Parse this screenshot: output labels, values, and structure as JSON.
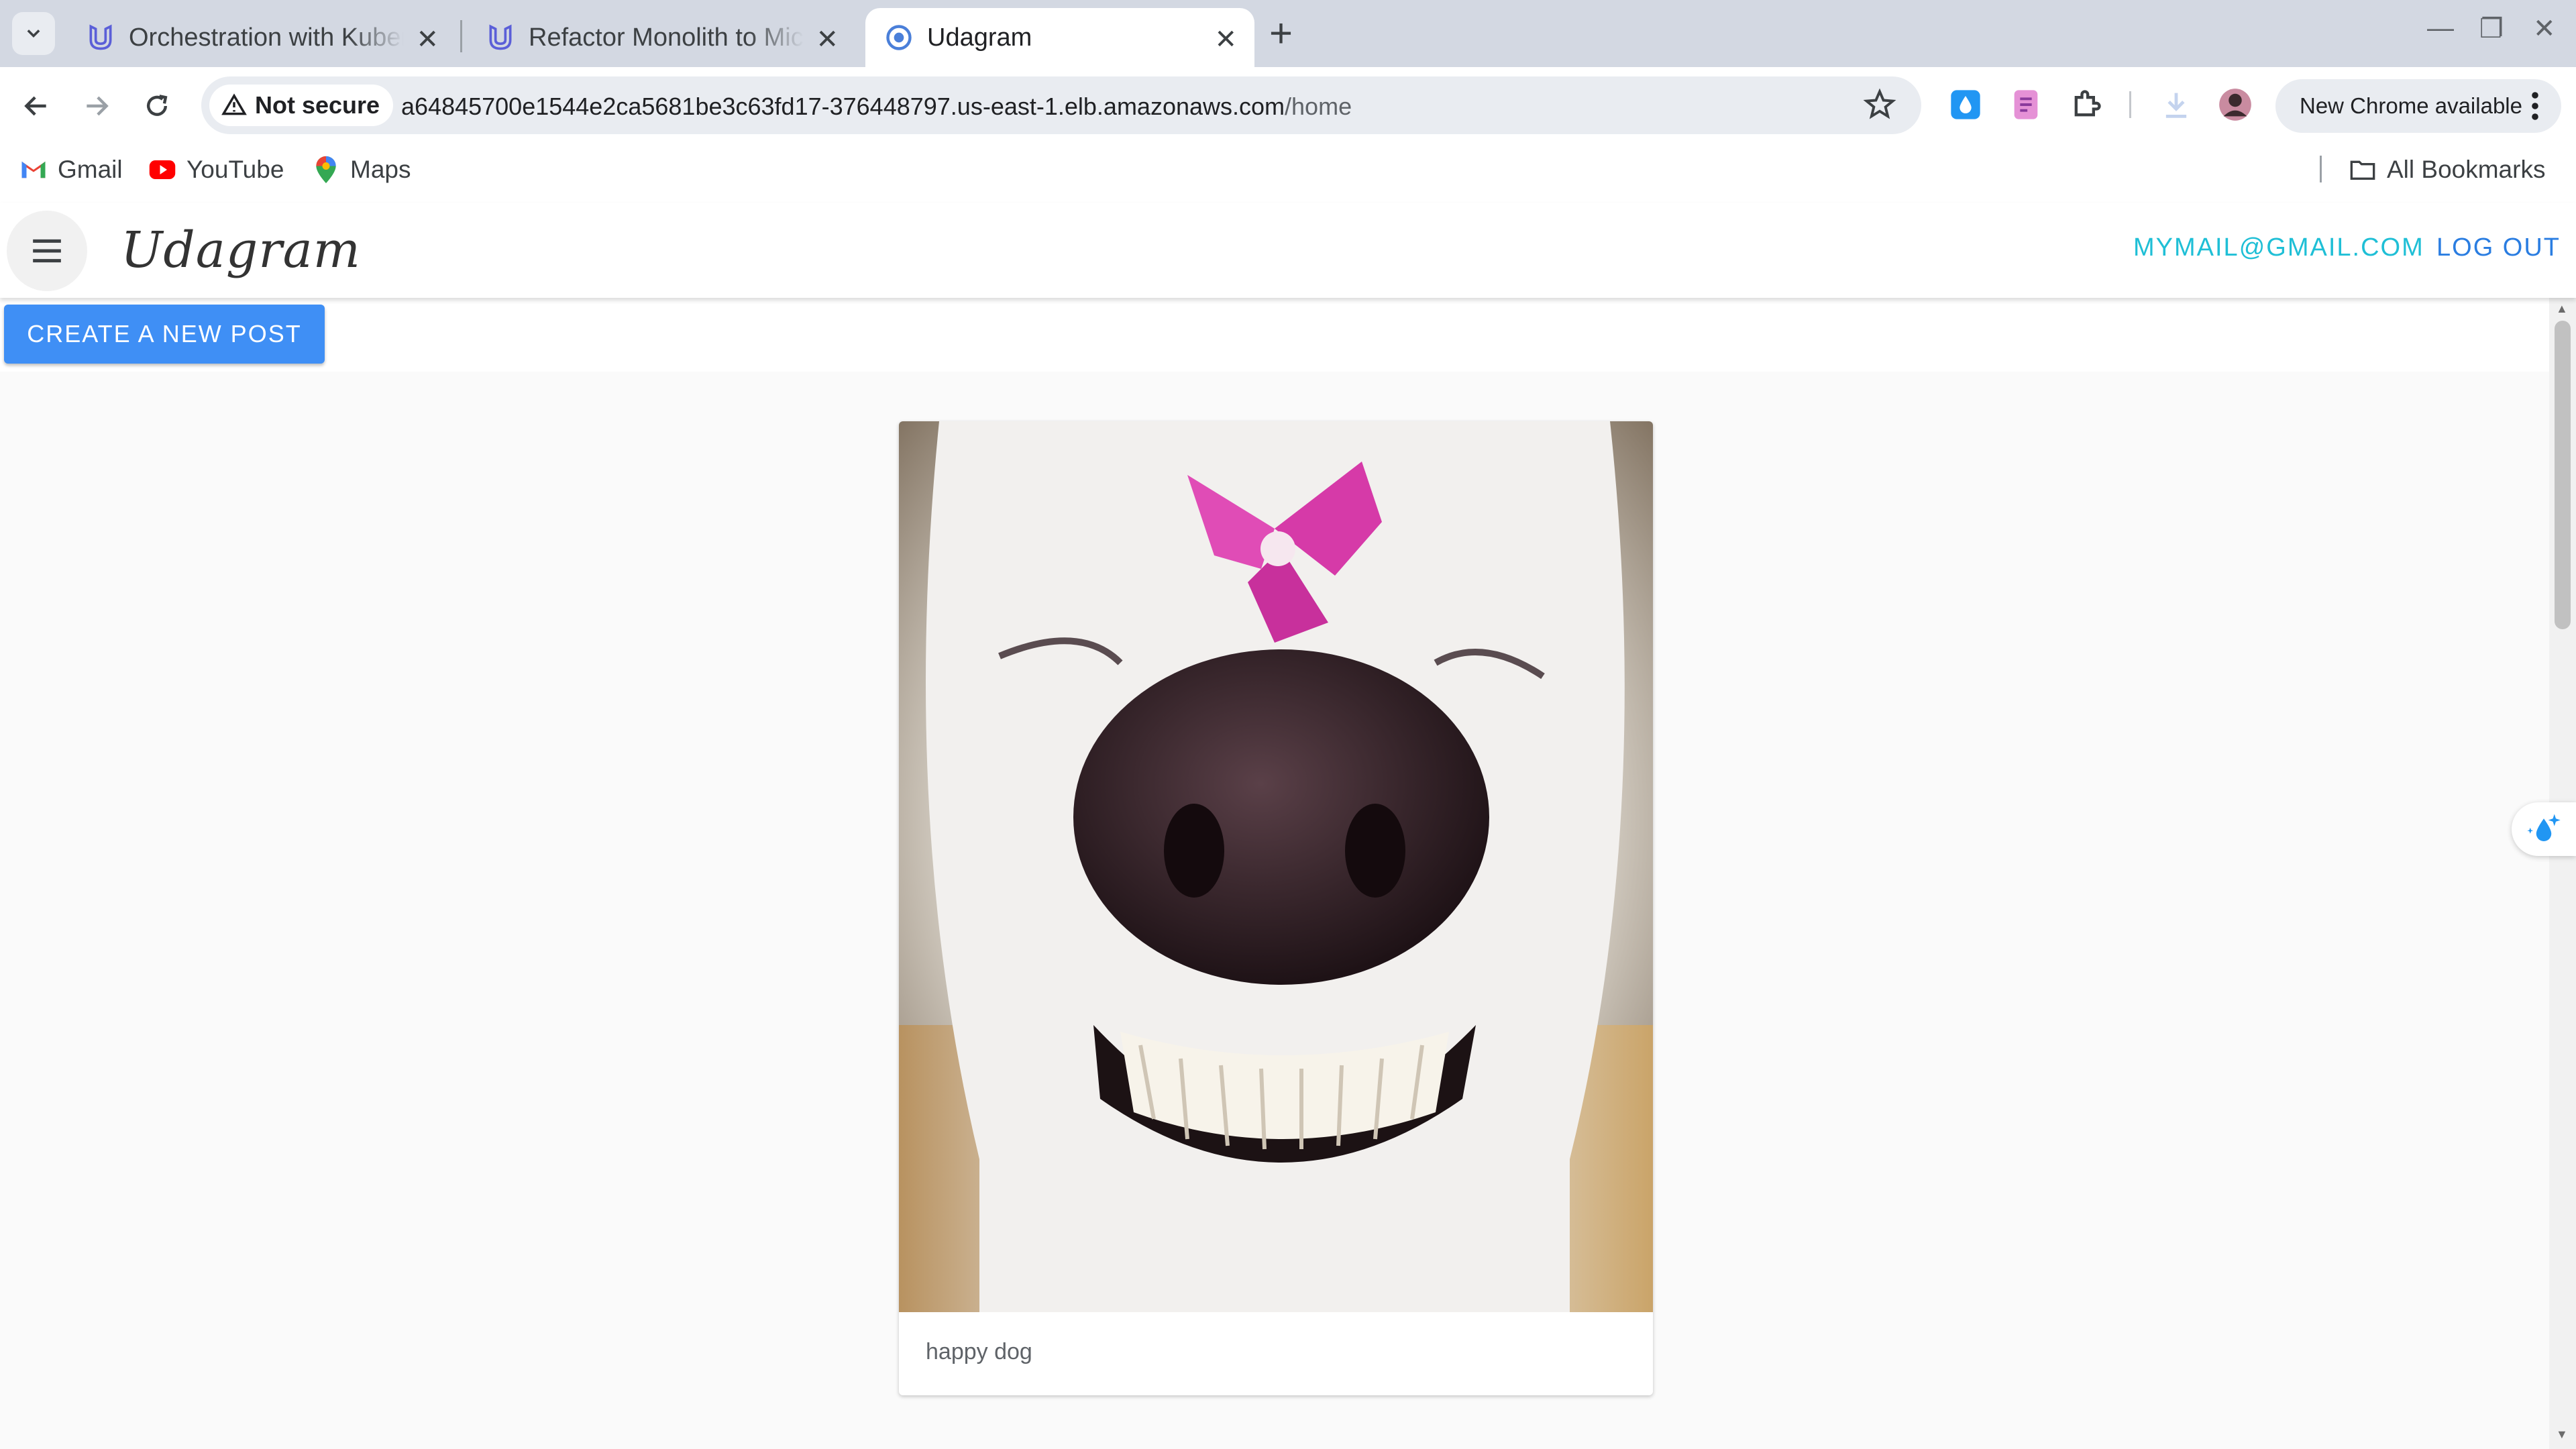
{
  "browser": {
    "tabs": [
      {
        "title": "Orchestration with Kubernetes",
        "active": false
      },
      {
        "title": "Refactor Monolith to Microservices",
        "active": false
      },
      {
        "title": "Udagram",
        "active": true
      }
    ],
    "not_secure_label": "Not secure",
    "url_host": "a64845700e1544e2ca5681be3c63fd17-376448797.us-east-1.elb.amazonaws.com",
    "url_path": "/home",
    "new_chrome_label": "New Chrome available",
    "bookmarks": [
      {
        "label": "Gmail",
        "icon": "gmail-icon"
      },
      {
        "label": "YouTube",
        "icon": "youtube-icon"
      },
      {
        "label": "Maps",
        "icon": "maps-icon"
      }
    ],
    "all_bookmarks_label": "All Bookmarks"
  },
  "app": {
    "brand": "Udagram",
    "user_email": "MYMAIL@GMAIL.COM",
    "logout_label": "LOG OUT",
    "create_post_label": "CREATE A NEW POST",
    "posts": [
      {
        "caption": "happy dog",
        "image": "smiling white dog with pink flower"
      }
    ]
  },
  "colors": {
    "accent_blue": "#3f8ff5",
    "email_cyan": "#1fbfd6",
    "logout_blue": "#2a7de1",
    "tabstrip": "#d3d8e2"
  }
}
